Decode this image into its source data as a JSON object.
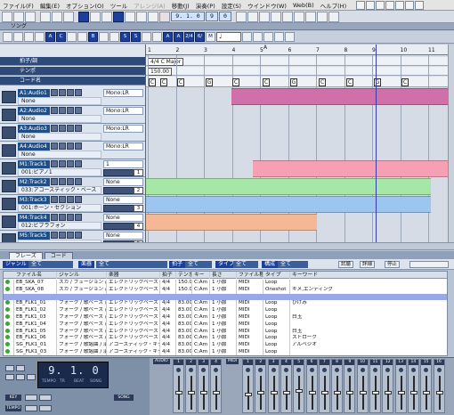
{
  "menubar": {
    "items": [
      "ファイル(F)",
      "編集(E)",
      "オプション(O)",
      "ツール",
      "アレンジ(A)",
      "移動(J)",
      "演奏(P)",
      "設定(S)",
      "ウインドウ(W)",
      "Web(B)",
      "ヘルプ(H)"
    ],
    "disabled_index": 4
  },
  "toolbar": {
    "position_value": "9. 1. 0",
    "tempo_value": "9",
    "meter_value": "0"
  },
  "song": {
    "title": "ソング"
  },
  "song_toolbar": {
    "labels": [
      "A",
      "C",
      "B",
      "S",
      "S",
      "A",
      "A",
      "2/4",
      "6/",
      "M"
    ],
    "note_value": "♩"
  },
  "ruler": {
    "marks": [
      "1",
      "2",
      "3",
      "4",
      "5",
      "6",
      "7",
      "8",
      "9",
      "10",
      "11"
    ],
    "section_marker": "A"
  },
  "global_rows": {
    "meter_label": "拍子/調",
    "meter_value": "4/4 C Major",
    "tempo_label": "テンポ",
    "tempo_value": "150.00",
    "chord_label": "コード名"
  },
  "chords": [
    "C",
    "C",
    "C",
    "G",
    "C",
    "C",
    "G",
    "C",
    "C",
    "G",
    "C"
  ],
  "tracks": [
    {
      "name": "A1:Audio1",
      "output": "Mono:LR",
      "sub": "None"
    },
    {
      "name": "A2:Audio2",
      "output": "Mono:LR",
      "sub": "None"
    },
    {
      "name": "A3:Audio3",
      "output": "Mono:LR",
      "sub": "None"
    },
    {
      "name": "A4:Audio4",
      "output": "Mono:LR",
      "sub": "None"
    },
    {
      "name": "M1:Track1",
      "output": "1",
      "sub": "001:ピアノ1",
      "channel": "1"
    },
    {
      "name": "M2:Track2",
      "output": "None",
      "sub": "033:アコースティック・ベース",
      "channel": "2"
    },
    {
      "name": "M3:Track3",
      "output": "None",
      "sub": "001:ホーン・セクション",
      "channel": "3"
    },
    {
      "name": "M4:Track4",
      "output": "None",
      "sub": "012:ビブラフォン",
      "channel": "4"
    },
    {
      "name": "M5:Track5",
      "output": "None",
      "sub": "",
      "channel": "5"
    }
  ],
  "lower_tabs": [
    "フレーズ",
    "コード"
  ],
  "filter": {
    "genre_label": "ジャンル",
    "genre_value": "全て",
    "name_label": "楽器",
    "name_value": "全て",
    "meter_label": "拍子",
    "meter_value": "全て",
    "type_label": "タイプ",
    "type_value": "全て",
    "struct_label": "構成",
    "struct_value": "全て",
    "btn1": "試聴",
    "btn2": "詳細",
    "btn3": "停止"
  },
  "table": {
    "headers": [
      "",
      "ファイル名",
      "ジャンル",
      "楽器",
      "拍子",
      "テンポ",
      "キー",
      "長さ",
      "ファイル種別",
      "タイプ",
      "キーワード"
    ],
    "rows": [
      [
        "EB_SKA_07",
        "スカ / フュージョン / 歌謡...",
        "エレクトリックベース",
        "4/4",
        "150.00",
        "C:Am",
        "1 小節",
        "MIDI",
        "Loop",
        ""
      ],
      [
        "EB_SKA_08",
        "スカ / フュージョン / 歌謡...",
        "エレクトリックベース",
        "4/4",
        "150.00",
        "C:Am",
        "1 小節",
        "MIDI",
        "Oneshot",
        "キメ,エンディング"
      ],
      [
        "",
        "",
        "",
        "",
        "",
        "",
        "",
        "",
        "",
        ""
      ],
      [
        "EB_FLK1_01",
        "フォーク / 歌ベース / ロック / ...",
        "エレクトリックベース",
        "4/4",
        "83.00",
        "C:Am",
        "1 小節",
        "MIDI",
        "Loop",
        "ひけみ"
      ],
      [
        "EB_FLK1_02",
        "フォーク / 歌ベース / ロック / ...",
        "エレクトリックベース",
        "4/4",
        "83.00",
        "C:Am",
        "1 小節",
        "MIDI",
        "Loop",
        ""
      ],
      [
        "EB_FLK1_03",
        "フォーク / 歌ベース / ロック / ...",
        "エレクトリックベース",
        "4/4",
        "83.00",
        "C:Am",
        "1 小節",
        "MIDI",
        "Loop",
        "白玉"
      ],
      [
        "EB_FLK1_04",
        "フォーク / 歌ベース / ロック / ...",
        "エレクトリックベース",
        "4/4",
        "83.00",
        "C:Am",
        "1 小節",
        "MIDI",
        "Loop",
        ""
      ],
      [
        "EB_FLK1_05",
        "フォーク / 歌ベース / ロック / ...",
        "エレクトリックベース",
        "4/4",
        "83.00",
        "C:Am",
        "1 小節",
        "MIDI",
        "Loop",
        "白玉"
      ],
      [
        "EB_FLK1_06",
        "フォーク / 歌ベース / ロック / ...",
        "エレクトリックベース",
        "4/4",
        "83.00",
        "C:Am",
        "1 小節",
        "MIDI",
        "Loop",
        "ストローク"
      ],
      [
        "SG_FLK1_01",
        "フォーク / 歌謡曲 / 演...",
        "アコースティック・ギター(スチール)",
        "4/4",
        "83.00",
        "C:Am",
        "1 小節",
        "MIDI",
        "Loop",
        "アルペジオ"
      ],
      [
        "SG_FLK1_03",
        "フォーク / 歌謡曲 / 演...",
        "アコースティック・ギター(スチール)",
        "4/4",
        "83.00",
        "C:Am",
        "1 小節",
        "MIDI",
        "Loop",
        ""
      ],
      [
        "SG_FLK1_04",
        "フォーク / 歌謡曲 / 演...",
        "アコースティック・ギター(スチール)",
        "4/4",
        "83.00",
        "C:Am",
        "1 小節",
        "MIDI",
        "Loop",
        ""
      ]
    ],
    "selected_row": 2
  },
  "transport": {
    "time": "9. 1. 0",
    "labels": [
      "TEMPO",
      "TR",
      "BEAT",
      "SONG"
    ],
    "key_label": "KEY",
    "tempo_label": "TEMPO",
    "tempo_btn": "SONG"
  },
  "mixer": {
    "audio_label": "AUDIO",
    "midi_label": "MIDI",
    "audio_strips": [
      "1",
      "2",
      "3",
      "4"
    ],
    "midi_strips": [
      "1",
      "2",
      "3",
      "4",
      "5",
      "6",
      "7",
      "8",
      "9",
      "10",
      "11",
      "12",
      "13",
      "14",
      "15",
      "16"
    ]
  },
  "colors": {
    "audio_clip": "#d070a8",
    "midi1_clip": "#f6a0b4",
    "midi2_clip": "#a6e6a6",
    "midi3_clip": "#9cc6f0",
    "midi4_clip": "#f4b894",
    "playhead": "#3a3aa8"
  }
}
